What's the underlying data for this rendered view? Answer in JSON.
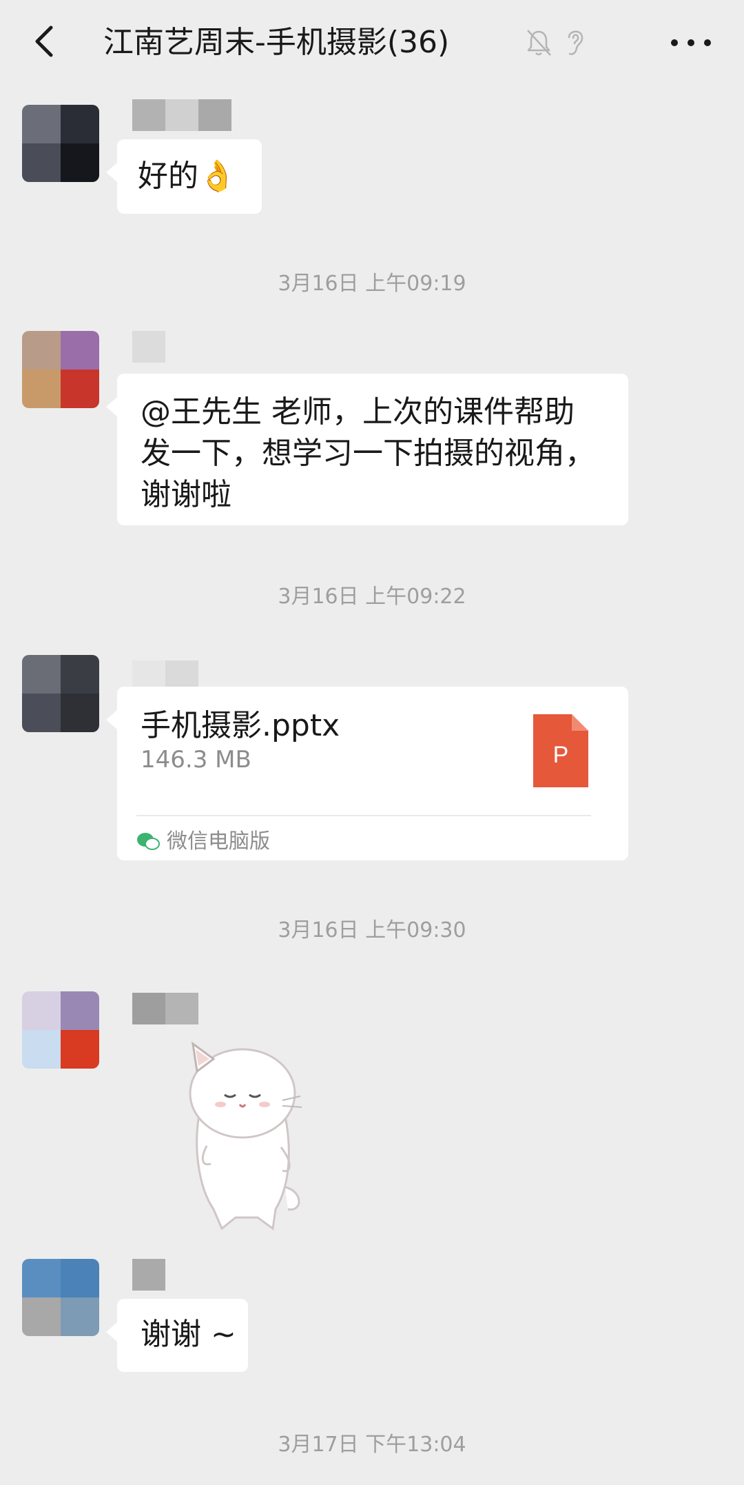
{
  "header": {
    "title": "江南艺周末-手机摄影(36)",
    "back_icon": "chevron-left-icon",
    "mute_icon": "bell-off-icon",
    "earpiece_icon": "ear-icon",
    "more_icon": "more-dots-icon"
  },
  "messages": [
    {
      "type": "text",
      "text": "好的👌"
    },
    {
      "type": "timestamp",
      "text": "3月16日 上午09:19"
    },
    {
      "type": "text",
      "line1": "@王先生  老师，上次的课件帮助",
      "line2": "发一下，想学习一下拍摄的视角，",
      "line3": "谢谢啦"
    },
    {
      "type": "timestamp",
      "text": "3月16日 上午09:22"
    },
    {
      "type": "file",
      "file_name": "手机摄影.pptx",
      "file_size": "146.3 MB",
      "file_icon_letter": "P",
      "source": "微信电脑版"
    },
    {
      "type": "timestamp",
      "text": "3月16日 上午09:30"
    },
    {
      "type": "sticker",
      "sticker_icon": "white-cat-sticker"
    },
    {
      "type": "text",
      "text": "谢谢 ~"
    },
    {
      "type": "timestamp",
      "text": "3月17日 下午13:04"
    }
  ],
  "colors": {
    "background": "#ededed",
    "bubble": "#ffffff",
    "ppt_icon": "#e5583a",
    "timestamp": "#9e9e9e"
  }
}
